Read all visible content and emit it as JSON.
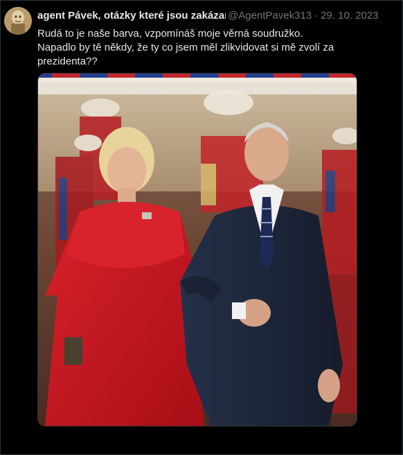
{
  "tweet": {
    "display_name": "agent Pávek, otázky které jsou zakázané",
    "handle": "@AgentPavek313",
    "separator": "·",
    "date": "29. 10. 2023",
    "text_lines": [
      "Rudá to je naše barva, vzpomínáš moje věrná soudružko.",
      "Napadlo by tě někdy, že ty co jsem měl zlikvidovat si mě zvolí za",
      "prezidenta??"
    ]
  },
  "media": {
    "kind": "photo",
    "accent_colors": {
      "red_dress": "#c8141c",
      "navy_suit": "#1e2638",
      "flag_red": "#c1272d",
      "flag_blue": "#1f3f8f"
    }
  },
  "colors": {
    "background": "#000000",
    "text": "#e7e9ea",
    "muted": "#71767b",
    "border": "#2f3336"
  }
}
